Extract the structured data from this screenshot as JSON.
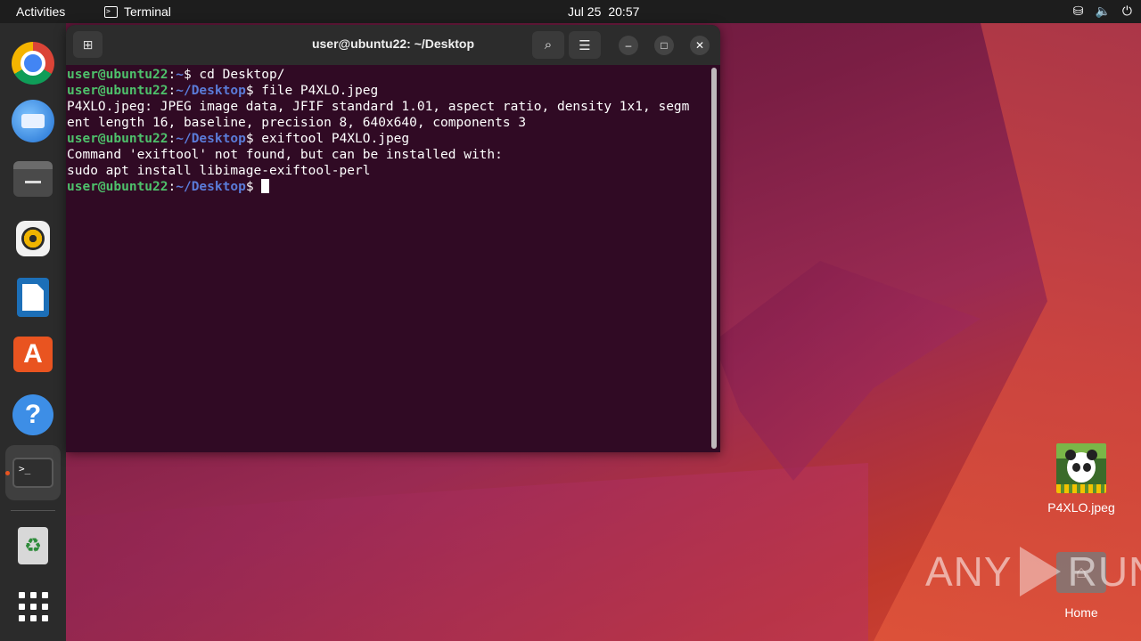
{
  "topbar": {
    "activities": "Activities",
    "app_name": "Terminal",
    "date": "Jul 25",
    "time": "20:57",
    "tray_icons": [
      "network-icon",
      "volume-icon",
      "power-icon"
    ]
  },
  "dock": {
    "items": [
      {
        "name": "chrome",
        "icon": "chrome-icon"
      },
      {
        "name": "thunderbird",
        "icon": "thunderbird-icon"
      },
      {
        "name": "files",
        "icon": "files-icon"
      },
      {
        "name": "rhythmbox",
        "icon": "rhythmbox-icon"
      },
      {
        "name": "libreoffice-writer",
        "icon": "writer-icon"
      },
      {
        "name": "app-center",
        "icon": "app-center-icon"
      },
      {
        "name": "help",
        "icon": "help-icon"
      },
      {
        "name": "terminal",
        "icon": "terminal-icon",
        "running": true
      },
      {
        "name": "trash",
        "icon": "trash-icon"
      },
      {
        "name": "show-apps",
        "icon": "apps-grid-icon"
      }
    ],
    "terminal_glyph": ">_",
    "help_glyph": "?",
    "appcenter_glyph": "A",
    "trash_glyph": "♻"
  },
  "terminal": {
    "title": "user@ubuntu22: ~/Desktop",
    "lines": [
      {
        "type": "prompt",
        "user": "user@ubuntu22",
        "sep": ":",
        "path": "~",
        "dollar": "$ ",
        "cmd": "cd Desktop/"
      },
      {
        "type": "prompt",
        "user": "user@ubuntu22",
        "sep": ":",
        "path": "~/Desktop",
        "dollar": "$ ",
        "cmd": "file P4XLO.jpeg"
      },
      {
        "type": "output",
        "text": "P4XLO.jpeg: JPEG image data, JFIF standard 1.01, aspect ratio, density 1x1, segm"
      },
      {
        "type": "output",
        "text": "ent length 16, baseline, precision 8, 640x640, components 3"
      },
      {
        "type": "prompt",
        "user": "user@ubuntu22",
        "sep": ":",
        "path": "~/Desktop",
        "dollar": "$ ",
        "cmd": "exiftool P4XLO.jpeg"
      },
      {
        "type": "output",
        "text": "Command 'exiftool' not found, but can be installed with:"
      },
      {
        "type": "output",
        "text": "sudo apt install libimage-exiftool-perl"
      },
      {
        "type": "prompt",
        "user": "user@ubuntu22",
        "sep": ":",
        "path": "~/Desktop",
        "dollar": "$ ",
        "cmd": ""
      }
    ]
  },
  "desktop": {
    "file_label": "P4XLO.jpeg",
    "home_label": "Home"
  },
  "watermark": {
    "left": "ANY",
    "right": "RUN"
  }
}
